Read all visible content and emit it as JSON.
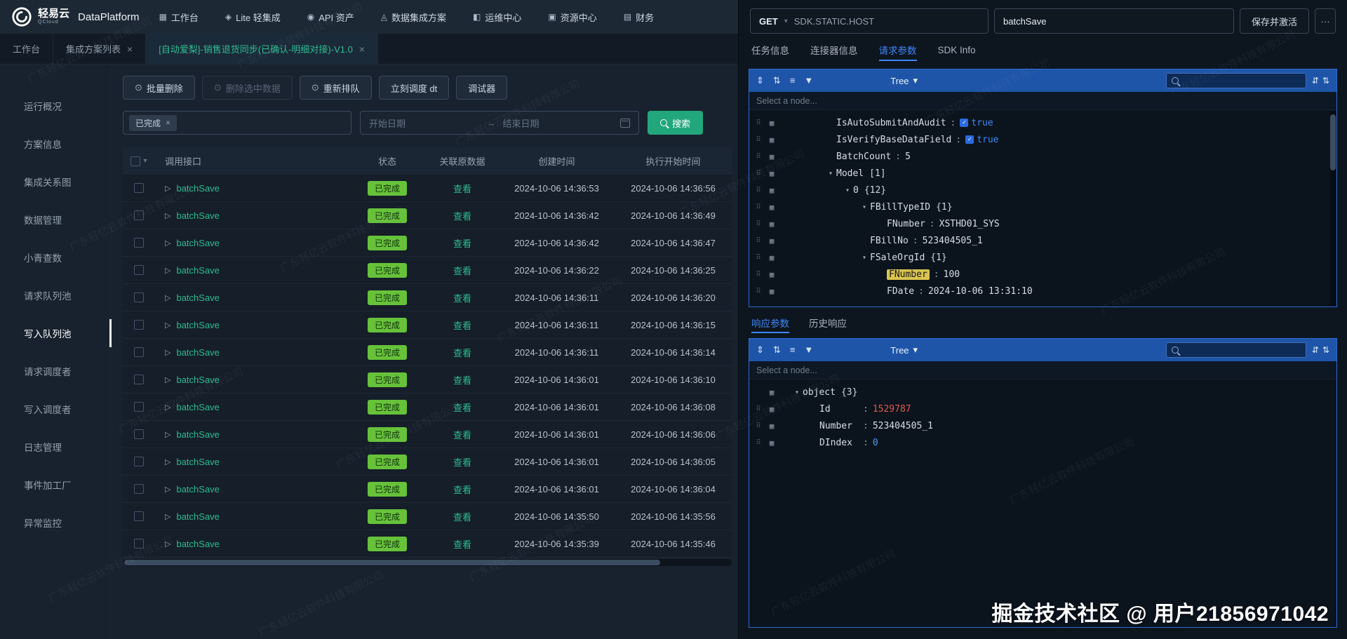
{
  "navbar": {
    "brand": {
      "name": "轻易云",
      "sub": "QCloud",
      "product": "DataPlatform"
    },
    "items": [
      {
        "label": "工作台"
      },
      {
        "label": "Lite 轻集成"
      },
      {
        "label": "API 资产"
      },
      {
        "label": "数据集成方案"
      },
      {
        "label": "运维中心"
      },
      {
        "label": "资源中心"
      },
      {
        "label": "财务"
      }
    ]
  },
  "tab_bar": {
    "tabs": [
      {
        "label": "工作台"
      },
      {
        "label": "集成方案列表"
      },
      {
        "label": "[自动爱梨]-销售退货同步(已确认-明细对接)-V1.0"
      }
    ]
  },
  "sidebar": {
    "items": [
      "运行概况",
      "方案信息",
      "集成关系图",
      "数据管理",
      "小青查数",
      "请求队列池",
      "写入队列池",
      "请求调度者",
      "写入调度者",
      "日志管理",
      "事件加工厂",
      "异常监控"
    ],
    "active": "写入队列池"
  },
  "toolbar": {
    "batch_delete": "批量删除",
    "delete_selected": "删除选中数据",
    "requeue": "重新排队",
    "dispatch_now": "立刻调度 dt",
    "debugger": "调试器"
  },
  "filters": {
    "status_tag": "已完成",
    "start_placeholder": "开始日期",
    "end_placeholder": "结束日期",
    "search": "搜索"
  },
  "table": {
    "headers": {
      "api": "调用接口",
      "status": "状态",
      "source": "关联原数据",
      "created": "创建时间",
      "started": "执行开始时间"
    },
    "rows": [
      {
        "api": "batchSave",
        "status": "已完成",
        "link": "查看",
        "created": "2024-10-06 14:36:53",
        "started": "2024-10-06 14:36:56"
      },
      {
        "api": "batchSave",
        "status": "已完成",
        "link": "查看",
        "created": "2024-10-06 14:36:42",
        "started": "2024-10-06 14:36:49"
      },
      {
        "api": "batchSave",
        "status": "已完成",
        "link": "查看",
        "created": "2024-10-06 14:36:42",
        "started": "2024-10-06 14:36:47"
      },
      {
        "api": "batchSave",
        "status": "已完成",
        "link": "查看",
        "created": "2024-10-06 14:36:22",
        "started": "2024-10-06 14:36:25"
      },
      {
        "api": "batchSave",
        "status": "已完成",
        "link": "查看",
        "created": "2024-10-06 14:36:11",
        "started": "2024-10-06 14:36:20"
      },
      {
        "api": "batchSave",
        "status": "已完成",
        "link": "查看",
        "created": "2024-10-06 14:36:11",
        "started": "2024-10-06 14:36:15"
      },
      {
        "api": "batchSave",
        "status": "已完成",
        "link": "查看",
        "created": "2024-10-06 14:36:11",
        "started": "2024-10-06 14:36:14"
      },
      {
        "api": "batchSave",
        "status": "已完成",
        "link": "查看",
        "created": "2024-10-06 14:36:01",
        "started": "2024-10-06 14:36:10"
      },
      {
        "api": "batchSave",
        "status": "已完成",
        "link": "查看",
        "created": "2024-10-06 14:36:01",
        "started": "2024-10-06 14:36:08"
      },
      {
        "api": "batchSave",
        "status": "已完成",
        "link": "查看",
        "created": "2024-10-06 14:36:01",
        "started": "2024-10-06 14:36:06"
      },
      {
        "api": "batchSave",
        "status": "已完成",
        "link": "查看",
        "created": "2024-10-06 14:36:01",
        "started": "2024-10-06 14:36:05"
      },
      {
        "api": "batchSave",
        "status": "已完成",
        "link": "查看",
        "created": "2024-10-06 14:36:01",
        "started": "2024-10-06 14:36:04"
      },
      {
        "api": "batchSave",
        "status": "已完成",
        "link": "查看",
        "created": "2024-10-06 14:35:50",
        "started": "2024-10-06 14:35:56"
      },
      {
        "api": "batchSave",
        "status": "已完成",
        "link": "查看",
        "created": "2024-10-06 14:35:39",
        "started": "2024-10-06 14:35:46"
      }
    ]
  },
  "request_bar": {
    "method": "GET",
    "host": "SDK.STATIC.HOST",
    "endpoint": "batchSave",
    "save": "保存并激活",
    "more": "···"
  },
  "rp_tabs": {
    "task": "任务信息",
    "connector": "连接器信息",
    "request": "请求参数",
    "sdk": "SDK Info"
  },
  "tree_ui": {
    "mode": "Tree",
    "hint": "Select a node..."
  },
  "request_tree": [
    {
      "key": "IsAutoSubmitAndAudit",
      "value": "true"
    },
    {
      "key": "IsVerifyBaseDataField",
      "value": "true"
    },
    {
      "key": "BatchCount",
      "value": "5"
    },
    {
      "key": "Model",
      "suffix": "[1]"
    },
    {
      "key": "0",
      "suffix": "{12}"
    },
    {
      "key": "FBillTypeID",
      "suffix": "{1}"
    },
    {
      "key": "FNumber",
      "value": "XSTHD01_SYS"
    },
    {
      "key": "FBillNo",
      "value": "523404505_1"
    },
    {
      "key": "FSaleOrgId",
      "suffix": "{1}"
    },
    {
      "key": "FNumber",
      "value": "100"
    },
    {
      "key": "FDate",
      "value": "2024-10-06 13:31:10"
    }
  ],
  "response_tabs": {
    "response": "响应参数",
    "history": "历史响应"
  },
  "response_tree": [
    {
      "key": "object",
      "suffix": "{3}"
    },
    {
      "key": "Id",
      "value": "1529787"
    },
    {
      "key": "Number",
      "value": "523404505_1"
    },
    {
      "key": "DIndex",
      "value": "0"
    }
  ],
  "watermarks": {
    "company": "广东轻亿云软件科技有限公司",
    "credit": "掘金技术社区 @ 用户21856971042"
  },
  "colors": {
    "accent_teal": "#22a77c",
    "success_badge": "#67c23a",
    "tree_header_blue": "#1e55a8",
    "active_tab_blue": "#3f87f5",
    "highlight_yellow": "#d9c44f",
    "number_red": "#e05a4f",
    "number_blue": "#4a9df8"
  }
}
